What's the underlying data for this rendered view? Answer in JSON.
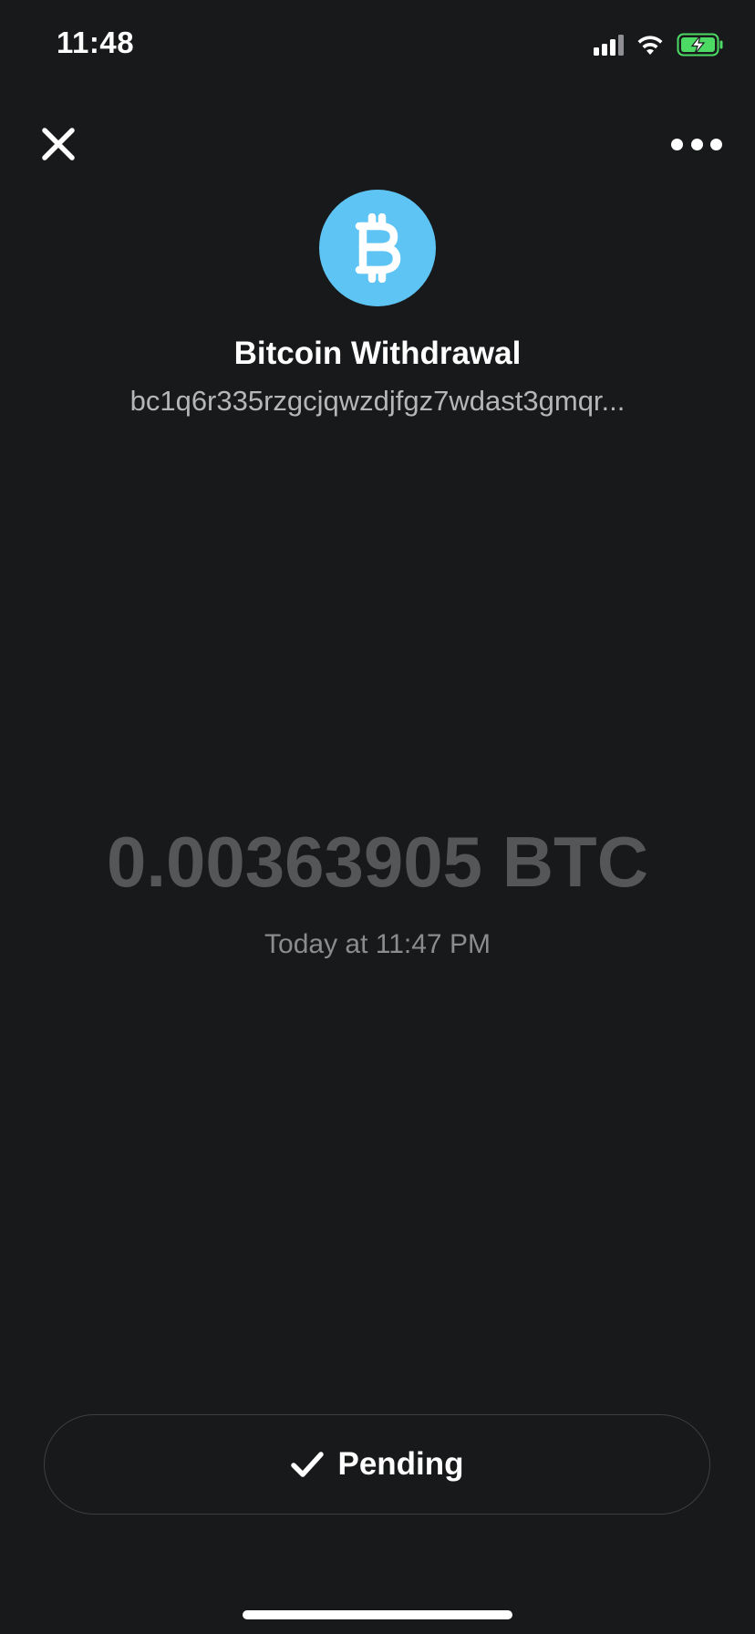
{
  "status_bar": {
    "time": "11:48",
    "icons": [
      "cellular-signal-icon",
      "wifi-icon",
      "battery-charging-icon"
    ],
    "battery_color": "#4cd964"
  },
  "header": {
    "close_icon": "close-icon",
    "more_icon": "more-options-icon"
  },
  "transaction": {
    "avatar_icon": "bitcoin-icon",
    "avatar_color": "#5ec4f4",
    "title": "Bitcoin Withdrawal",
    "address": "bc1q6r335rzgcjqwzdjfgz7wdast3gmqr...",
    "amount": "0.00363905 BTC",
    "timestamp": "Today at 11:47 PM"
  },
  "status_button": {
    "icon": "checkmark-icon",
    "label": "Pending"
  }
}
